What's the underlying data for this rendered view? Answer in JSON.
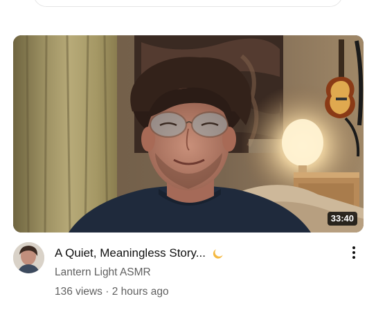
{
  "video": {
    "title": "A Quiet, Meaningless Story...",
    "title_emoji_icon": "crescent-moon-icon",
    "channel": "Lantern Light ASMR",
    "views": "136 views",
    "separator": "·",
    "age": "2 hours ago",
    "duration": "33:40"
  },
  "menu": {
    "icon": "more-vertical-icon"
  },
  "colors": {
    "title": "#0f0f0f",
    "secondary_text": "#606060",
    "duration_bg": "#000000",
    "moon": "#f5b942"
  }
}
